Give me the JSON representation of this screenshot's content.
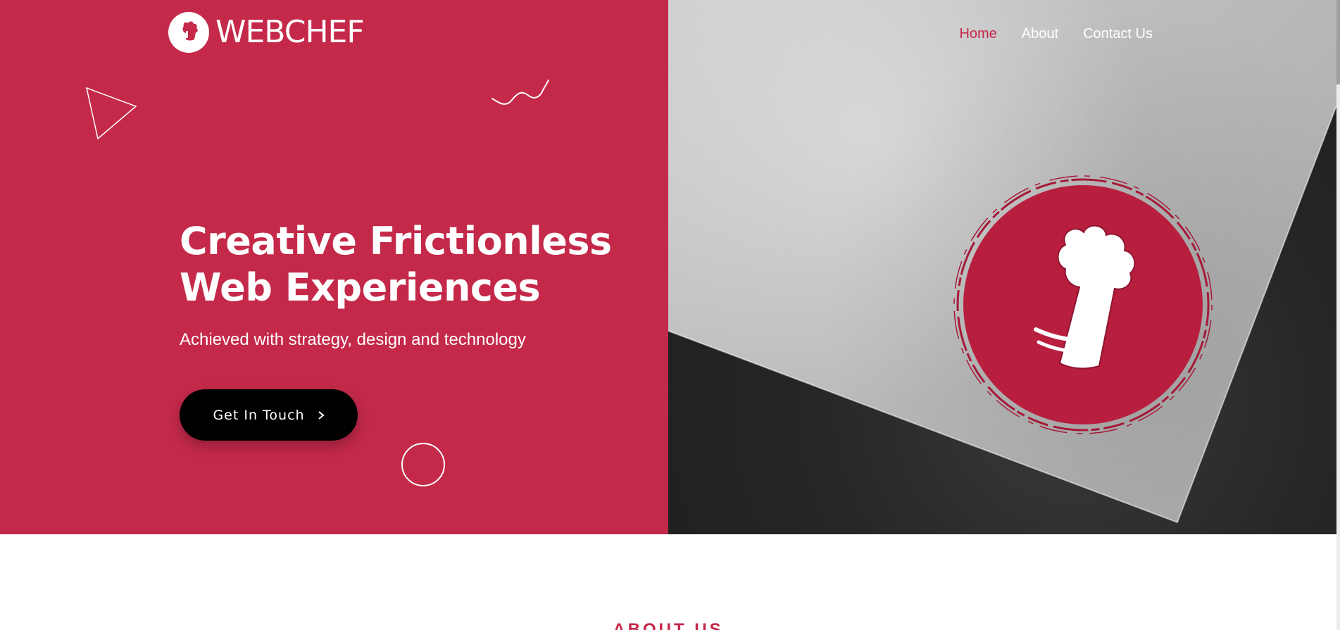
{
  "brand": {
    "name": "WEBCHEF",
    "logo_icon": "chef-hat-icon",
    "accent_color": "#c4294a"
  },
  "nav": {
    "items": [
      {
        "label": "Home",
        "active": true
      },
      {
        "label": "About",
        "active": false
      },
      {
        "label": "Contact Us",
        "active": false
      }
    ]
  },
  "hero": {
    "title": "Creative Frictionless Web Experiences",
    "subtitle": "Achieved with strategy, design and technology",
    "cta_label": "Get In Touch",
    "cta_icon": "chevron-right-icon",
    "background_color": "#c4294a",
    "image_description_icon": "chef-hat-stamp-icon"
  },
  "about": {
    "heading": "ABOUT US"
  }
}
